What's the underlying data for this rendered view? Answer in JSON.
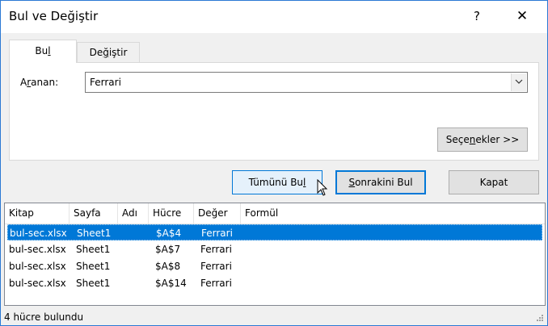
{
  "window": {
    "title": "Bul ve Değiştir",
    "help_glyph": "?",
    "close_glyph": "✕"
  },
  "tabs": {
    "find": {
      "pre": "Bu",
      "accel": "l",
      "post": ""
    },
    "replace": {
      "pre": "De",
      "accel": "ğ",
      "post": "iştir"
    }
  },
  "find_panel": {
    "label": {
      "pre": "A",
      "accel": "r",
      "post": "anan:"
    },
    "value": "Ferrari",
    "dropdown_icon": "chevron-down-icon"
  },
  "buttons": {
    "options": {
      "pre": "Seçe",
      "accel": "n",
      "post": "ekler >>"
    },
    "find_all": {
      "pre": "Tümünü Bu",
      "accel": "l",
      "post": ""
    },
    "find_next": {
      "pre": "",
      "accel": "S",
      "post": "onrakini Bul"
    },
    "close": "Kapat"
  },
  "results": {
    "columns": [
      "Kitap",
      "Sayfa",
      "Adı",
      "Hücre",
      "Değer",
      "Formül"
    ],
    "rows": [
      {
        "kitap": "bul-sec.xlsx",
        "sayfa": "Sheet1",
        "adi": "",
        "hucre": "$A$4",
        "deger": "Ferrari",
        "formul": "",
        "selected": true
      },
      {
        "kitap": "bul-sec.xlsx",
        "sayfa": "Sheet1",
        "adi": "",
        "hucre": "$A$7",
        "deger": "Ferrari",
        "formul": "",
        "selected": false
      },
      {
        "kitap": "bul-sec.xlsx",
        "sayfa": "Sheet1",
        "adi": "",
        "hucre": "$A$8",
        "deger": "Ferrari",
        "formul": "",
        "selected": false
      },
      {
        "kitap": "bul-sec.xlsx",
        "sayfa": "Sheet1",
        "adi": "",
        "hucre": "$A$14",
        "deger": "Ferrari",
        "formul": "",
        "selected": false
      }
    ]
  },
  "status": "4 hücre bulundu",
  "colors": {
    "accent": "#0078d7",
    "selected_row": "#0078d7"
  }
}
